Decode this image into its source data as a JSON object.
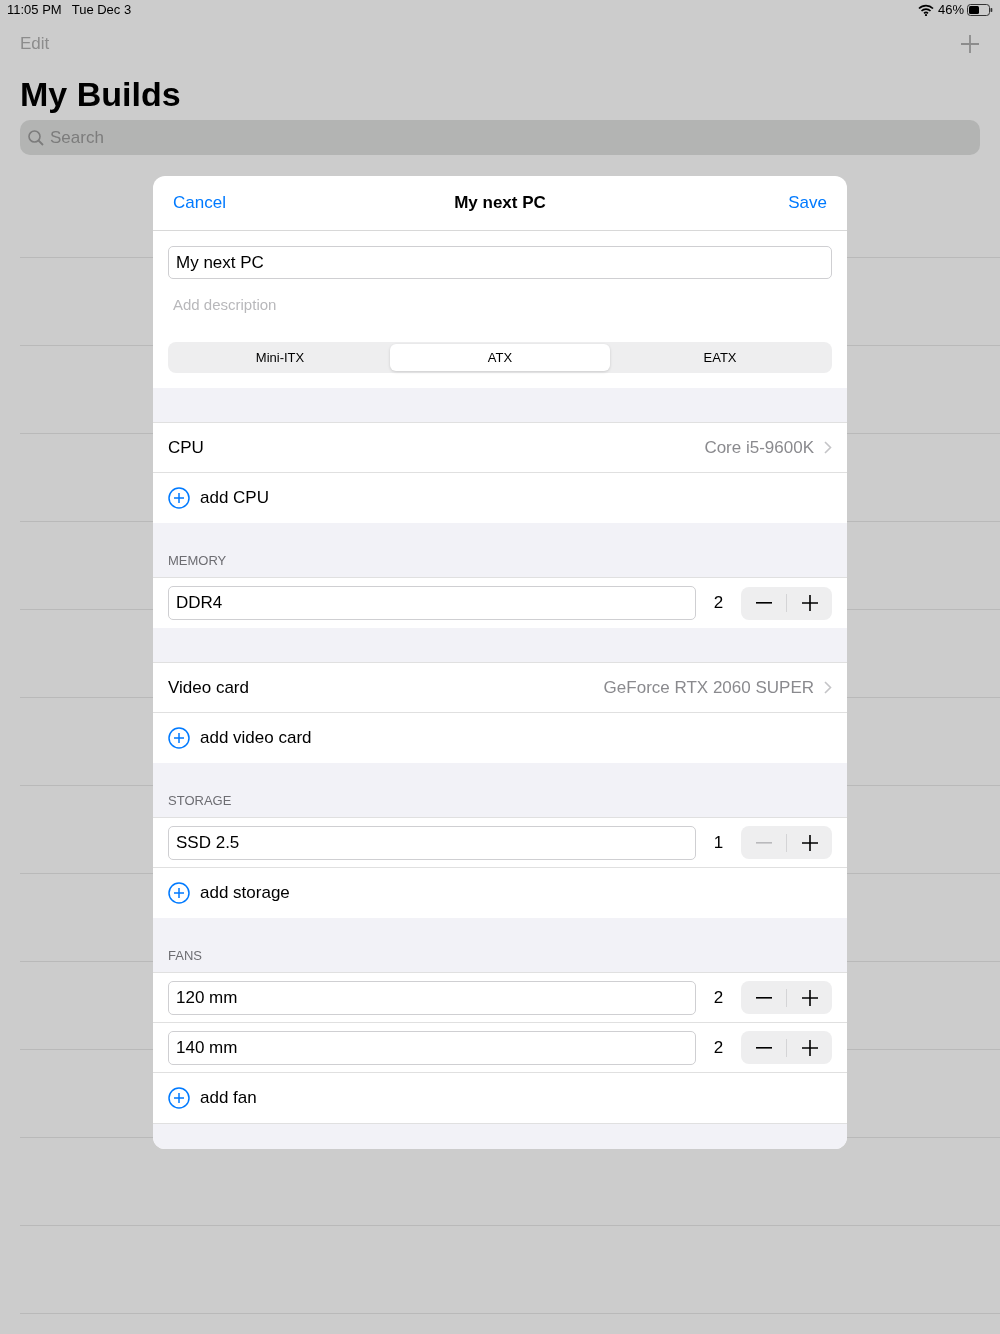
{
  "status_bar": {
    "time": "11:05 PM",
    "date": "Tue Dec 3",
    "battery": "46%"
  },
  "nav": {
    "edit": "Edit",
    "title": "My Builds",
    "search": {
      "placeholder": "Search"
    }
  },
  "modal": {
    "cancel": "Cancel",
    "title": "My next PC",
    "save": "Save",
    "name_field": {
      "value": "My next PC"
    },
    "description": {
      "placeholder": "Add description"
    },
    "segments": [
      {
        "label": "Mini-ITX",
        "selected": false
      },
      {
        "label": "ATX",
        "selected": true
      },
      {
        "label": "EATX",
        "selected": false
      }
    ],
    "sections": [
      {
        "rows": [
          {
            "kind": "picker",
            "label": "CPU",
            "value": "Core i5-9600K"
          },
          {
            "kind": "add",
            "label": "add CPU"
          }
        ]
      },
      {
        "header": "MEMORY",
        "rows": [
          {
            "kind": "stepper",
            "value": "DDR4",
            "count": "2",
            "decrement_disabled": false
          }
        ]
      },
      {
        "rows": [
          {
            "kind": "picker",
            "label": "Video card",
            "value": "GeForce RTX 2060 SUPER"
          },
          {
            "kind": "add",
            "label": "add video card"
          }
        ]
      },
      {
        "header": "STORAGE",
        "rows": [
          {
            "kind": "stepper",
            "value": "SSD 2.5",
            "count": "1",
            "decrement_disabled": true
          },
          {
            "kind": "add",
            "label": "add storage"
          }
        ]
      },
      {
        "header": "FANS",
        "rows": [
          {
            "kind": "stepper",
            "value": "120 mm",
            "count": "2",
            "decrement_disabled": false
          },
          {
            "kind": "stepper",
            "value": "140 mm",
            "count": "2",
            "decrement_disabled": false
          },
          {
            "kind": "add",
            "label": "add fan"
          }
        ]
      }
    ]
  }
}
